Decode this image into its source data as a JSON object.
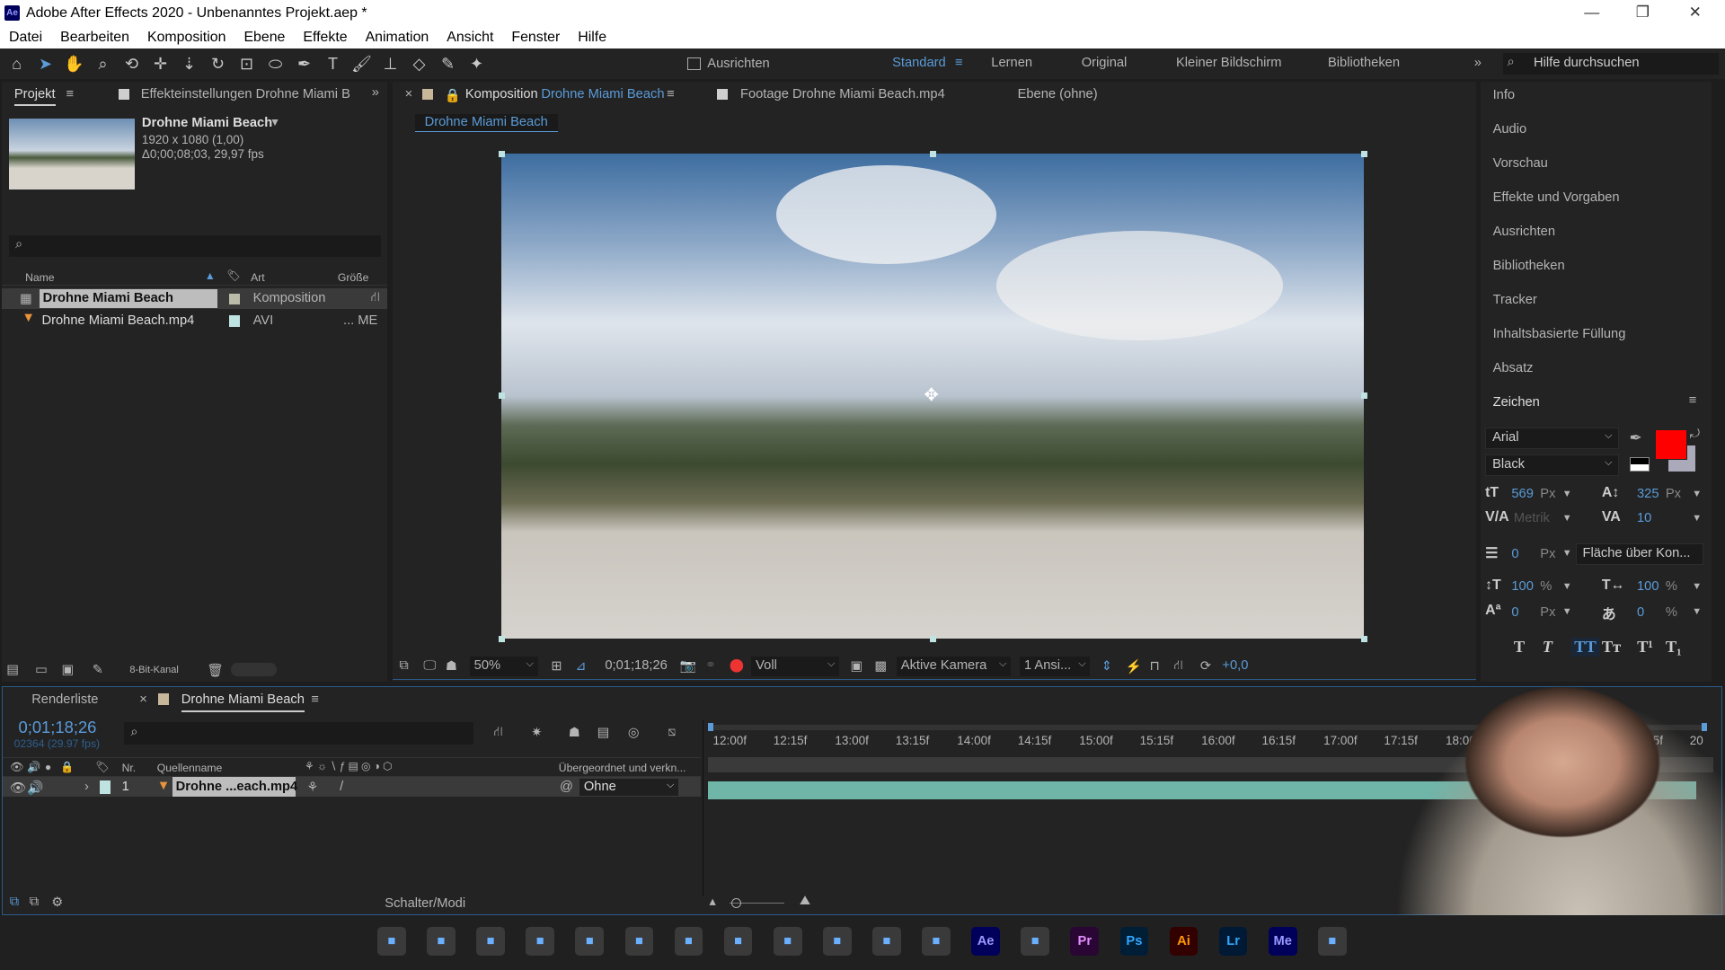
{
  "window": {
    "title": "Adobe After Effects 2020 - Unbenanntes Projekt.aep *",
    "app_icon": "Ae"
  },
  "menu": [
    "Datei",
    "Bearbeiten",
    "Komposition",
    "Ebene",
    "Effekte",
    "Animation",
    "Ansicht",
    "Fenster",
    "Hilfe"
  ],
  "toolbar": {
    "align_label": "Ausrichten",
    "workspaces": [
      "Standard",
      "Lernen",
      "Original",
      "Kleiner Bildschirm",
      "Bibliotheken"
    ],
    "active_workspace": "Standard",
    "search_placeholder": "Hilfe durchsuchen"
  },
  "project": {
    "tab": "Projekt",
    "effects_tab": "Effekteinstellungen Drohne Miami B",
    "comp_name": "Drohne Miami Beach",
    "comp_size": "1920 x 1080 (1,00)",
    "comp_duration": "Δ0;00;08;03, 29,97 fps",
    "columns": [
      "Name",
      "Art",
      "Größe"
    ],
    "items": [
      {
        "name": "Drohne Miami Beach",
        "type": "Komposition",
        "size": ""
      },
      {
        "name": "Drohne Miami Beach.mp4",
        "type": "AVI",
        "size": "... ME"
      }
    ],
    "bit_depth": "8-Bit-Kanal"
  },
  "viewer": {
    "comp_tab_prefix": "Komposition",
    "comp_tab_name": "Drohne Miami Beach",
    "footage_tab": "Footage  Drohne Miami Beach.mp4",
    "layer_tab": "Ebene  (ohne)",
    "breadcrumb": "Drohne Miami Beach",
    "zoom": "50%",
    "timecode": "0;01;18;26",
    "resolution": "Voll",
    "camera": "Aktive Kamera",
    "views": "1 Ansi...",
    "exposure": "+0,0"
  },
  "right_panels": [
    "Info",
    "Audio",
    "Vorschau",
    "Effekte und Vorgaben",
    "Ausrichten",
    "Bibliotheken",
    "Tracker",
    "Inhaltsbasierte Füllung",
    "Absatz"
  ],
  "character": {
    "title": "Zeichen",
    "font": "Arial",
    "style": "Black",
    "font_size": "569",
    "leading": "325",
    "kerning": "Metrik",
    "tracking": "10",
    "stroke": "0",
    "stroke_mode": "Fläche über Kon...",
    "vscale": "100",
    "hscale": "100",
    "baseline": "0",
    "tsume": "0",
    "unit_px": "Px",
    "unit_pct": "%",
    "fill_color": "#ff0000"
  },
  "timeline": {
    "render_tab": "Renderliste",
    "comp_tab": "Drohne Miami Beach",
    "timecode": "0;01;18;26",
    "frames": "02364 (29.97 fps)",
    "columns": {
      "nr": "Nr.",
      "source": "Quellenname",
      "parent": "Übergeordnet und verkn..."
    },
    "layers": [
      {
        "nr": "1",
        "name": "Drohne ...each.mp4",
        "parent": "Ohne"
      }
    ],
    "ticks": [
      "12:00f",
      "12:15f",
      "13:00f",
      "13:15f",
      "14:00f",
      "14:15f",
      "15:00f",
      "15:15f",
      "16:00f",
      "16:15f",
      "17:00f",
      "17:15f",
      "18:00f",
      "19:15f",
      "20"
    ],
    "switches_label": "Schalter/Modi"
  },
  "taskbar": [
    "windows",
    "search",
    "task-view",
    "widgets",
    "teams",
    "whatsapp",
    "app",
    "firefox",
    "app",
    "app",
    "app",
    "explorer",
    "Ae",
    "app",
    "Pr",
    "Ps",
    "Ai",
    "Lr",
    "Me",
    "folder"
  ]
}
